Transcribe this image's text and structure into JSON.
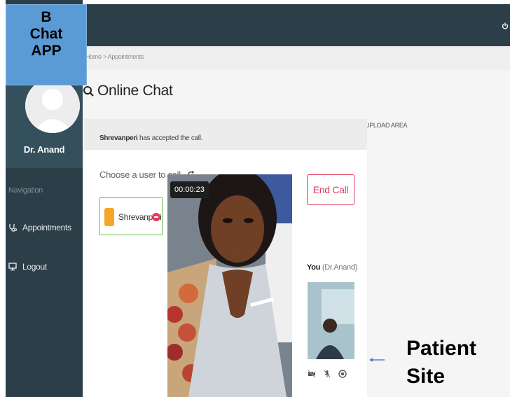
{
  "badge": {
    "line1": "B",
    "line2": "Chat",
    "line3": "APP"
  },
  "sidebar": {
    "doctor_name": "Dr. Anand",
    "nav_label": "Navigation",
    "items": [
      {
        "label": "Appointments",
        "icon": "stethoscope-icon"
      },
      {
        "label": "Logout",
        "icon": "monitor-icon"
      }
    ]
  },
  "topbar": {
    "icon": "power-icon"
  },
  "breadcrumb": "Home > Appointments",
  "page": {
    "title": "Online Chat",
    "upload_area": "UPLOAD AREA",
    "status": {
      "user": "Shrevanperi",
      "message": " has accepted the call."
    }
  },
  "call": {
    "choose_user": "Choose a user to call",
    "user_name": "Shrevanperi",
    "timer": "00:00:23",
    "end_call": "End Call",
    "you_prefix": "You",
    "you_name": "(Dr.Anand)"
  },
  "annotation": {
    "line1": "Patient",
    "line2": "Site"
  },
  "colors": {
    "sidebar": "#2c3e48",
    "accent_red": "#e23a5e",
    "badge_blue": "#5b9bd5",
    "user_border": "#5fbb4a"
  }
}
